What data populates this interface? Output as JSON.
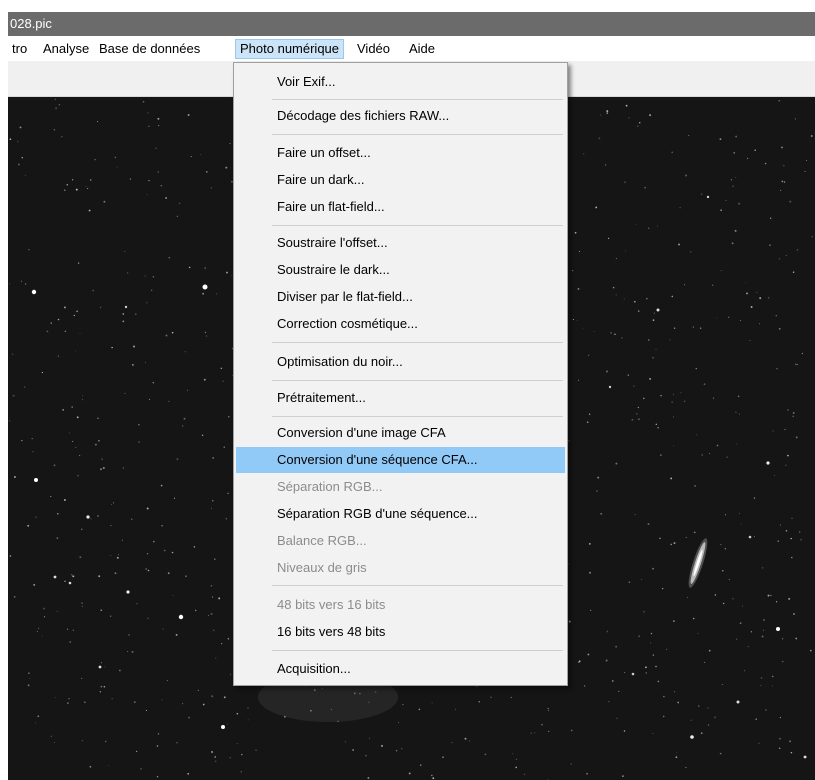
{
  "window": {
    "title": "028.pic"
  },
  "menubar": {
    "items": [
      {
        "label": "tro"
      },
      {
        "label": "Analyse"
      },
      {
        "label": "Base de données"
      },
      {
        "label": "Photo numérique"
      },
      {
        "label": "Vidéo"
      },
      {
        "label": "Aide"
      }
    ]
  },
  "menu": {
    "items": [
      {
        "label": "Voir Exif...",
        "enabled": true
      },
      {
        "label": "Décodage des fichiers RAW...",
        "enabled": true
      },
      {
        "label": "Faire un offset...",
        "enabled": true
      },
      {
        "label": "Faire un dark...",
        "enabled": true
      },
      {
        "label": "Faire un flat-field...",
        "enabled": true
      },
      {
        "label": "Soustraire l'offset...",
        "enabled": true
      },
      {
        "label": "Soustraire le dark...",
        "enabled": true
      },
      {
        "label": "Diviser par le flat-field...",
        "enabled": true
      },
      {
        "label": "Correction cosmétique...",
        "enabled": true
      },
      {
        "label": "Optimisation du noir...",
        "enabled": true
      },
      {
        "label": "Prétraitement...",
        "enabled": true
      },
      {
        "label": "Conversion d'une image CFA",
        "enabled": true
      },
      {
        "label": "Conversion d'une séquence CFA...",
        "enabled": true,
        "highlighted": true
      },
      {
        "label": "Séparation RGB...",
        "enabled": false
      },
      {
        "label": "Séparation RGB d'une séquence...",
        "enabled": true
      },
      {
        "label": "Balance RGB...",
        "enabled": false
      },
      {
        "label": "Niveaux de gris",
        "enabled": false
      },
      {
        "label": "48 bits vers 16 bits",
        "enabled": false
      },
      {
        "label": "16 bits vers 48 bits",
        "enabled": true
      },
      {
        "label": "Acquisition...",
        "enabled": true
      }
    ]
  },
  "colors": {
    "highlight": "#91c9f7",
    "disabled_text": "#8c8c8c",
    "title_bar": "#6b6b6b",
    "image_background": "#151515"
  }
}
